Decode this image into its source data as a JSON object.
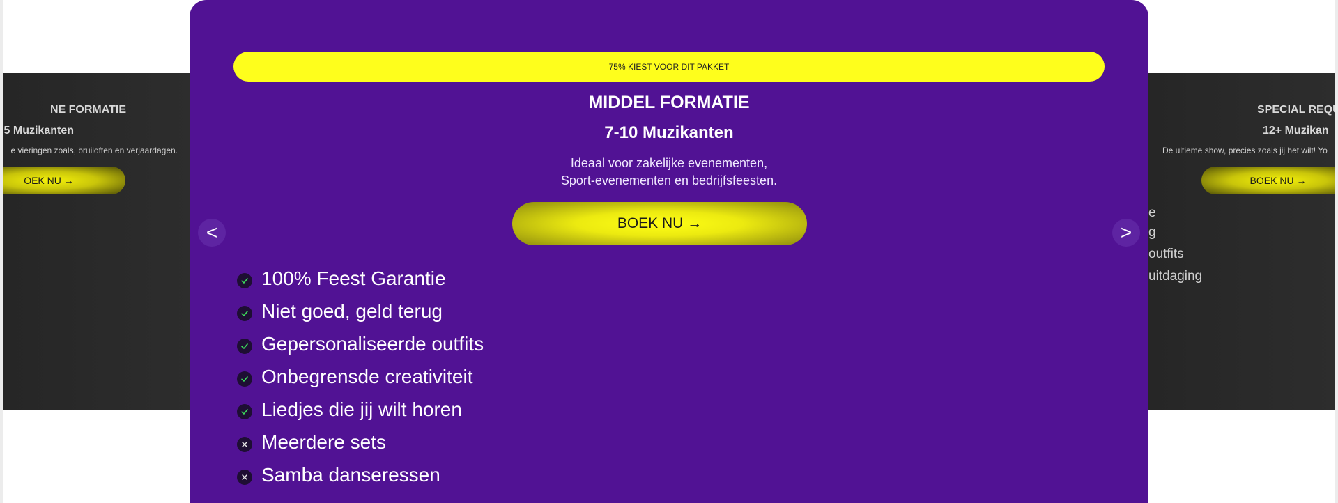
{
  "left_card": {
    "title": "NE FORMATIE",
    "subtitle": "5 Muzikanten",
    "description": "e vieringen zoals, bruiloften en verjaardagen.",
    "button": "OEK NU →"
  },
  "right_card": {
    "title": "SPECIAL REQU",
    "subtitle": "12+ Muzikan",
    "description": "De ultieme show, precies zoals jij het wilt! Yo",
    "button": "BOEK NU →",
    "features": [
      "e",
      "g",
      "outfits",
      "uitdaging"
    ]
  },
  "main_card": {
    "banner": "75% KIEST VOOR DIT PAKKET",
    "title": "MIDDEL FORMATIE",
    "subtitle": "7-10 Muzikanten",
    "description_line1": "Ideaal voor zakelijke evenementen,",
    "description_line2": "Sport-evenementen en bedrijfsfeesten.",
    "button": "BOEK NU →",
    "prev_label": "<",
    "next_label": ">",
    "features": [
      {
        "label": "100% Feest Garantie",
        "icon": "check-icon"
      },
      {
        "label": "Niet goed, geld terug",
        "icon": "check-icon"
      },
      {
        "label": "Gepersonaliseerde outfits",
        "icon": "check-icon"
      },
      {
        "label": "Onbegrensde creativiteit",
        "icon": "check-icon"
      },
      {
        "label": "Liedjes die jij wilt horen",
        "icon": "check-icon"
      },
      {
        "label": "Meerdere sets",
        "icon": "cross-icon"
      },
      {
        "label": "Samba danseressen",
        "icon": "cross-icon"
      }
    ]
  },
  "colors": {
    "main_bg": "#511294",
    "banner_bg": "#fefe1c",
    "button_yellow": "#ffff15",
    "side_bg": "#262626",
    "check_green": "#3ddc5c"
  }
}
